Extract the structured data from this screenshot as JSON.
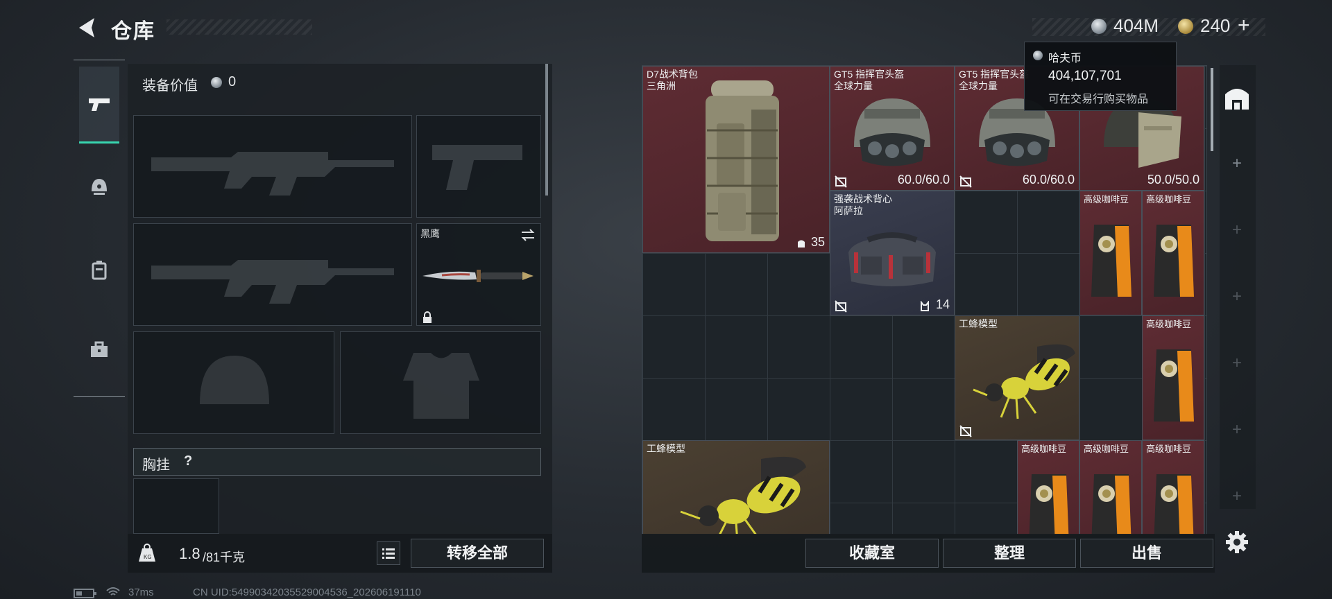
{
  "header": {
    "title": "仓库",
    "currency_silver": "404M",
    "currency_gold": "240",
    "plus": "+"
  },
  "tooltip": {
    "name": "哈夫币",
    "amount": "404,107,701",
    "desc": "可在交易行购买物品"
  },
  "equipment": {
    "value_label": "装备价值",
    "value": "0",
    "knife_name": "黑鹰",
    "chest_rig_label": "胸挂",
    "help": "?",
    "weight_current": "1.8",
    "weight_max": "/81千克",
    "transfer_all": "转移全部"
  },
  "items": {
    "backpack": {
      "name": "D7战术背包\n三角洲",
      "value": "35"
    },
    "helmet1": {
      "name": "GT5 指挥官头盔\n全球力量",
      "value": "60.0/60.0"
    },
    "helmet2": {
      "name": "GT5 指挥官头盔\n全球力量",
      "value": "60.0/60.0"
    },
    "helmet3": {
      "value": "50.0/50.0"
    },
    "vest": {
      "name": "强袭战术背心\n阿萨拉",
      "value": "14"
    },
    "coffee": "高级咖啡豆",
    "wasp": "工蜂模型"
  },
  "actions": {
    "collection": "收藏室",
    "sort": "整理",
    "sell": "出售"
  },
  "status": {
    "ping": "37ms",
    "uid": "CN UID:5499034203552900453​6_202606191110"
  },
  "colors": {
    "rarity_red": "#5e2c33",
    "rarity_blue": "#3a3e4f",
    "rarity_gold": "#4b4032",
    "coffee_orange": "#e88a1a",
    "wasp_yellow": "#d8d23a"
  }
}
